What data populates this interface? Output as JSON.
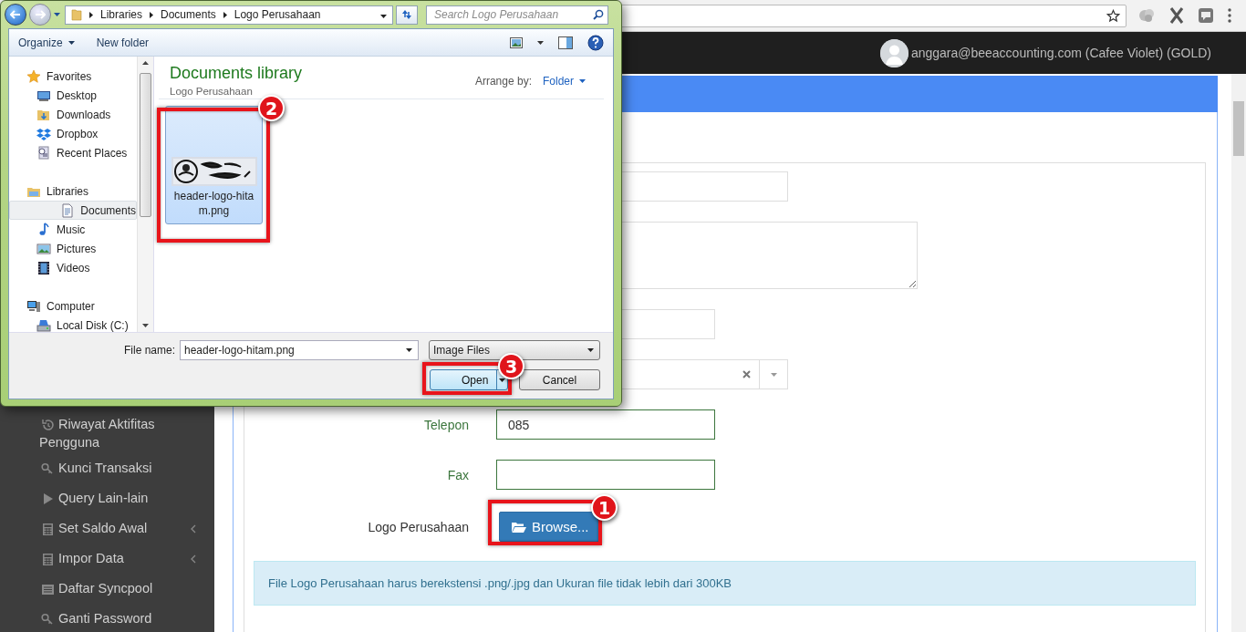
{
  "header": {
    "user": "anggara@beeaccounting.com (Cafee Violet) (GOLD)"
  },
  "sidebar": {
    "items": [
      {
        "label": "Riwayat Aktifitas Pengguna",
        "has_submenu": false
      },
      {
        "label": "Kunci Transaksi",
        "has_submenu": false
      },
      {
        "label": "Query Lain-lain",
        "has_submenu": false
      },
      {
        "label": "Set Saldo Awal",
        "has_submenu": true
      },
      {
        "label": "Impor Data",
        "has_submenu": true
      },
      {
        "label": "Daftar Syncpool",
        "has_submenu": false
      },
      {
        "label": "Ganti Password",
        "has_submenu": false
      }
    ]
  },
  "form": {
    "rows": [
      {
        "kind": "input",
        "valid": false
      },
      {
        "kind": "textarea",
        "valid": false
      },
      {
        "kind": "input",
        "valid": false
      },
      {
        "kind": "select",
        "valid": false
      },
      {
        "kind": "input",
        "label": "Telepon",
        "value": "085",
        "valid": true
      },
      {
        "kind": "input",
        "label": "Fax",
        "valid": true
      },
      {
        "kind": "browse",
        "label": "Logo Perusahaan",
        "button": "Browse..."
      }
    ],
    "info": "File Logo Perusahaan harus berekstensi .png/.jpg dan Ukuran file tidak lebih dari 300KB"
  },
  "dialog": {
    "breadcrumb": [
      "Libraries",
      "Documents",
      "Logo Perusahaan"
    ],
    "search": {
      "placeholder": "Search Logo Perusahaan"
    },
    "toolbar": {
      "organize": "Organize",
      "new_folder": "New folder"
    },
    "nav": [
      {
        "label": "Favorites",
        "selected": false,
        "children": [
          {
            "label": "Desktop",
            "selected": false
          },
          {
            "label": "Downloads",
            "selected": false
          },
          {
            "label": "Dropbox",
            "selected": false
          },
          {
            "label": "Recent Places",
            "selected": false
          }
        ]
      },
      {
        "label": "Libraries",
        "selected": false,
        "children": [
          {
            "label": "Documents",
            "selected": true
          },
          {
            "label": "Music",
            "selected": false
          },
          {
            "label": "Pictures",
            "selected": false
          },
          {
            "label": "Videos",
            "selected": false
          }
        ]
      },
      {
        "label": "Computer",
        "selected": false,
        "children": [
          {
            "label": "Local Disk (C:)",
            "selected": false
          }
        ]
      }
    ],
    "library_title": "Documents library",
    "library_subtitle": "Logo Perusahaan",
    "arrange_label": "Arrange by:",
    "arrange_value": "Folder",
    "files": [
      {
        "name": "header-logo-hitam.png",
        "selected": true,
        "kind": "picture"
      }
    ],
    "file_name": {
      "label": "File name:",
      "value": "header-logo-hitam.png"
    },
    "file_type": "Image Files",
    "buttons": [
      {
        "label": "Open",
        "kind": "split"
      },
      {
        "label": "Cancel",
        "kind": "plain"
      }
    ]
  },
  "annotations": [
    {
      "number": "1"
    },
    {
      "number": "2"
    },
    {
      "number": "3"
    }
  ]
}
